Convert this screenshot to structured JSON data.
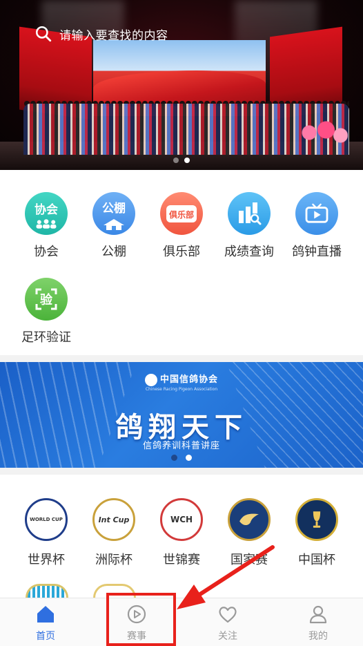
{
  "search": {
    "placeholder": "请输入要查找的内容"
  },
  "banner": {
    "slide_count": 2,
    "active_slide": 2
  },
  "features": [
    {
      "label": "协会",
      "icon": "association-icon",
      "icon_text": "协会",
      "color": "#2bc4b3"
    },
    {
      "label": "公棚",
      "icon": "loft-icon",
      "icon_text": "公棚",
      "color": "#4a95ea"
    },
    {
      "label": "俱乐部",
      "icon": "club-icon",
      "icon_text": "俱乐部",
      "color": "#f36a52"
    },
    {
      "label": "成绩查询",
      "icon": "score-query-icon",
      "color": "#3aa8ee"
    },
    {
      "label": "鸽钟直播",
      "icon": "live-tv-icon",
      "color": "#4a9cef"
    },
    {
      "label": "足环验证",
      "icon": "ring-verify-icon",
      "icon_text": "验",
      "color": "#5cbf47"
    }
  ],
  "ad": {
    "org_name": "中国信鸽协会",
    "org_en": "Chinese Racing Pigeon Association",
    "headline": "鸽翔天下",
    "subtitle": "信鸽养训科普讲座",
    "slide_count": 2,
    "active_slide": 2
  },
  "cups": [
    {
      "label": "世界杯",
      "badge": "WORLD CUP",
      "icon": "world-cup-logo"
    },
    {
      "label": "洲际杯",
      "badge": "Int Cup",
      "icon": "intercontinental-cup-logo"
    },
    {
      "label": "世锦赛",
      "badge": "WCH",
      "icon": "world-championship-logo"
    },
    {
      "label": "国家赛",
      "badge": "",
      "icon": "national-race-logo"
    },
    {
      "label": "中国杯",
      "badge": "",
      "icon": "china-cup-logo"
    }
  ],
  "tabs": [
    {
      "label": "首页",
      "icon": "home-icon",
      "active": true
    },
    {
      "label": "赛事",
      "icon": "play-circle-icon",
      "active": false
    },
    {
      "label": "关注",
      "icon": "heart-icon",
      "active": false
    },
    {
      "label": "我的",
      "icon": "user-icon",
      "active": false
    }
  ],
  "colors": {
    "accent": "#2f6fe0",
    "annotation": "#e8211b",
    "inactive": "#9a9a9a"
  }
}
